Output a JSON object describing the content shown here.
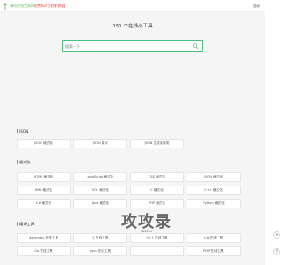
{
  "header": {
    "site_name": "薄荷在线工具网",
    "promo": "免费PDF文档转换器",
    "login": "登录"
  },
  "headline": "151 个在线小工具",
  "search": {
    "placeholder": "搜索一下"
  },
  "sections": [
    {
      "title": "JSON",
      "items": [
        "JSON 格式化",
        "JSON 转义",
        "JSON 生成实体类"
      ]
    },
    {
      "title": "格式化",
      "items": [
        "HTML 格式化",
        "JavaScript 格式化",
        "CSS 格式化",
        "JSON 格式化",
        "XML 格式化",
        "SQL 格式化",
        "C 格式化",
        "C++ 格式化",
        "C# 格式化",
        "Java 格式化",
        "PHP 格式化",
        "Python 格式化"
      ]
    },
    {
      "title": "编译工具",
      "items": [
        "Assembly 在线工具",
        "C 在线工具",
        "C++ 在线工具",
        "C# 在线工具",
        "Go 在线工具",
        "Java 在线工具",
        "",
        "PHP 在线工具"
      ]
    }
  ],
  "watermark": {
    "text": "攻攻录",
    "sub": "tool.lu"
  },
  "floating_buttons": [
    "+",
    "↑"
  ]
}
